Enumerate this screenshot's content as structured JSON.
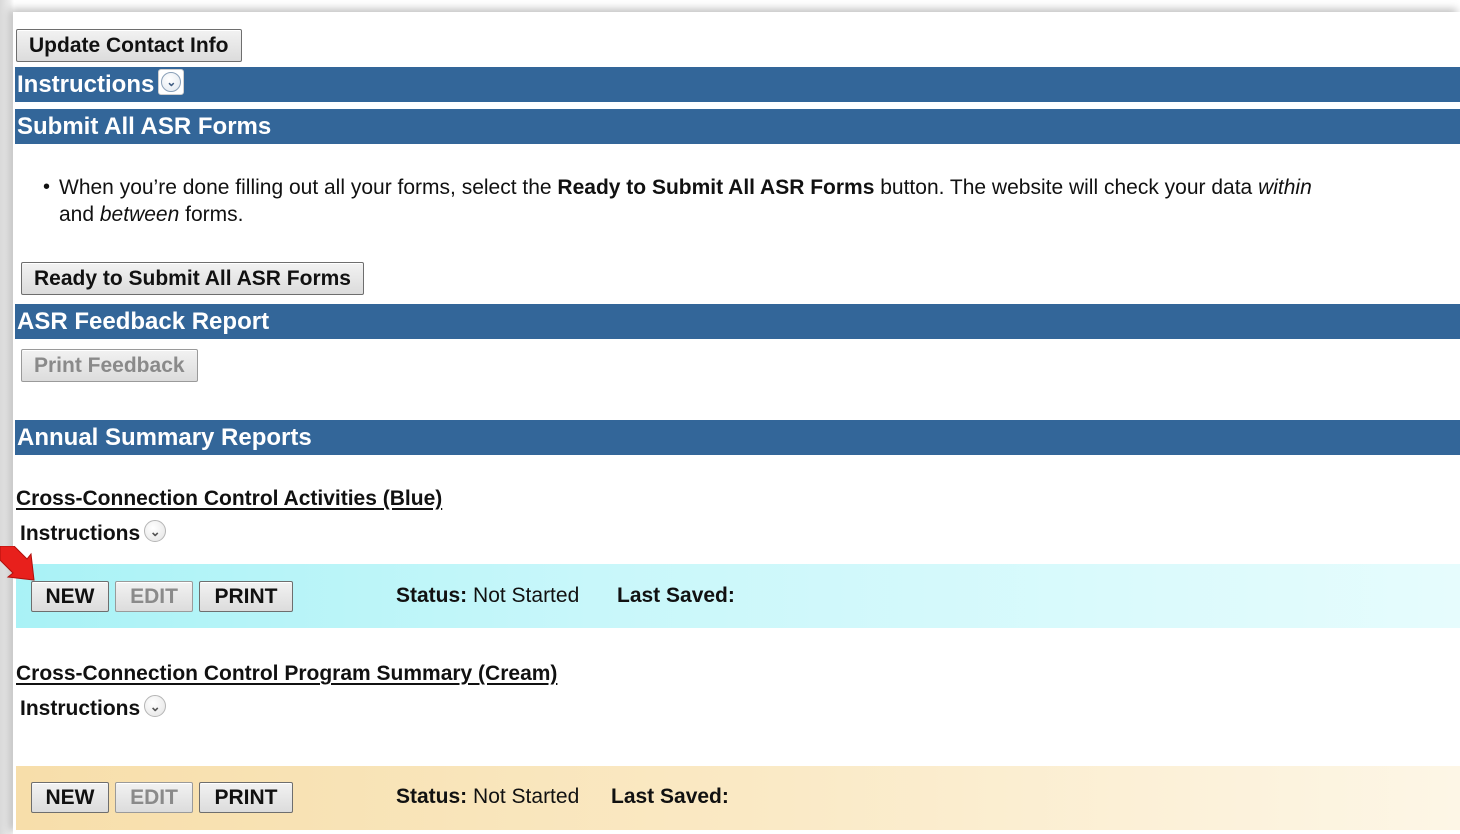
{
  "contact": {
    "update_label": "Update Contact Info"
  },
  "instructions_bar": {
    "title": "Instructions"
  },
  "submit_section": {
    "title": "Submit All ASR Forms",
    "bullet_part1": "When you’re done filling out all your forms, select the ",
    "bullet_bold": "Ready to Submit All ASR Forms",
    "bullet_part2": " button. The website will check your data ",
    "bullet_italic1": "within",
    "bullet_line2_start": " and ",
    "bullet_italic2": "between",
    "bullet_end": " forms.",
    "button_label": "Ready to Submit All ASR Forms"
  },
  "feedback_section": {
    "title": "ASR Feedback Report",
    "print_label": "Print Feedback"
  },
  "reports_section": {
    "title": "Annual Summary Reports"
  },
  "forms": [
    {
      "title": "Cross-Connection Control Activities (Blue)",
      "instructions_label": "Instructions",
      "new_label": "NEW",
      "edit_label": "EDIT",
      "print_label": "PRINT",
      "status_label": "Status:",
      "status_value": "Not Started",
      "last_saved_label": "Last Saved:",
      "row_color": "#a9f2f6"
    },
    {
      "title": "Cross-Connection Control Program Summary (Cream)",
      "instructions_label": "Instructions",
      "new_label": "NEW",
      "edit_label": "EDIT",
      "print_label": "PRINT",
      "status_label": "Status:",
      "status_value": "Not Started",
      "last_saved_label": "Last Saved:",
      "row_color": "#f7deaa"
    }
  ],
  "colors": {
    "section_bar": "#336699",
    "pointer_arrow": "#e8201c"
  },
  "icons": {
    "expand": "chevron-down-icon",
    "pointer": "red-arrow-icon"
  }
}
